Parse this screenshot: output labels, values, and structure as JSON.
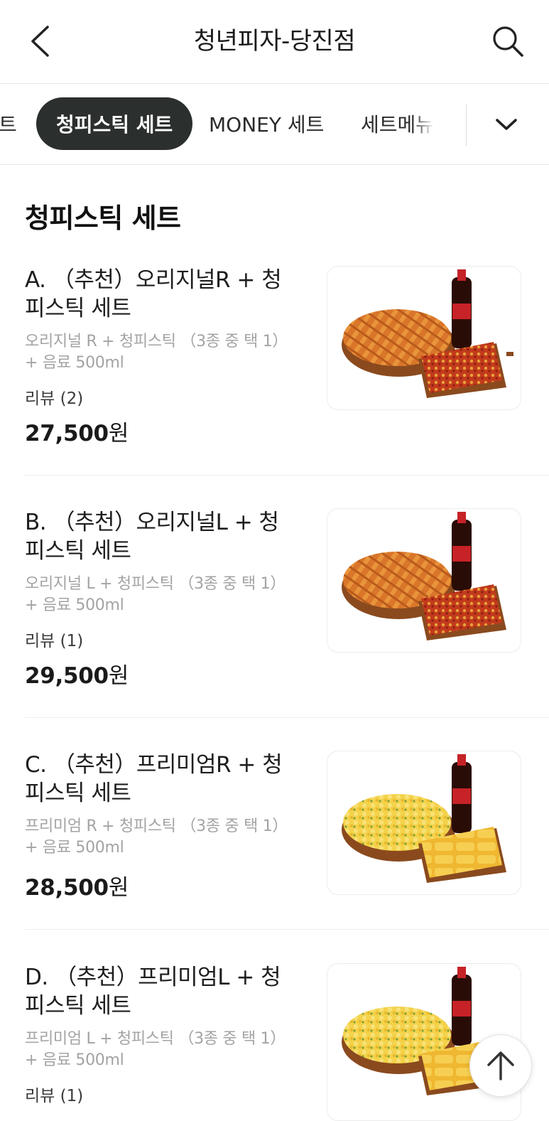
{
  "header": {
    "title": "청년피자-당진점",
    "back_icon": "chevron-left-icon",
    "search_icon": "search-icon"
  },
  "tabs": {
    "items": [
      {
        "label": "트"
      },
      {
        "label": "청피스틱 세트",
        "active": true
      },
      {
        "label": "MONEY 세트"
      },
      {
        "label": "세트메뉴"
      }
    ],
    "more_icon": "chevron-down-icon",
    "active_color": "#2b2f2e"
  },
  "section": {
    "title": "청피스틱 세트"
  },
  "menu": {
    "items": [
      {
        "name": "A. （추천）오리지널R + 청피스틱 세트",
        "desc": "오리지널 R + 청피스틱 （3종 중 택 1） + 음료 500ml",
        "review": "리뷰 (2)",
        "price_num": "27,500",
        "price_unit": "원",
        "pizza": "cheese-fries-pizza"
      },
      {
        "name": "B. （추천）오리지널L + 청피스틱 세트",
        "desc": "오리지널 L + 청피스틱 （3종 중 택 1） + 음료 500ml",
        "review": "리뷰 (1)",
        "price_num": "29,500",
        "price_unit": "원",
        "pizza": "cheese-fries-pizza"
      },
      {
        "name": "C. （추천）프리미엄R + 청피스틱 세트",
        "desc": "프리미엄 R + 청피스틱 （3종 중 택 1） + 음료 500ml",
        "review": "",
        "price_num": "28,500",
        "price_unit": "원",
        "pizza": "corn-premium-pizza"
      },
      {
        "name": "D. （추천）프리미엄L + 청피스틱 세트",
        "desc": "프리미엄 L + 청피스틱 （3종 중 택 1） + 음료 500ml",
        "review": "리뷰 (1)",
        "price_num": "",
        "price_unit": "",
        "pizza": "corn-premium-pizza"
      }
    ]
  },
  "scroll_top_icon": "arrow-up-icon"
}
